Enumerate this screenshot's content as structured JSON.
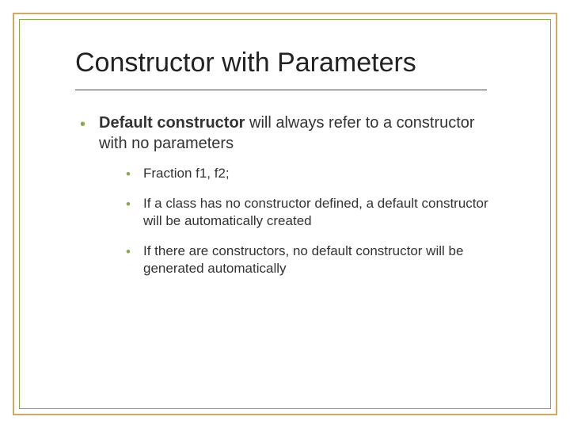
{
  "slide": {
    "title": "Constructor with Parameters",
    "bullets": [
      {
        "bold_prefix": "Default constructor",
        "rest": " will always refer to a constructor with no parameters",
        "children": [
          {
            "text": "Fraction f1, f2;"
          },
          {
            "text": "If a class has no constructor defined, a default constructor will be automatically created"
          },
          {
            "text": "If there are constructors, no default constructor will be generated automatically"
          }
        ]
      }
    ]
  },
  "colors": {
    "outer_border": "#d4a95f",
    "inner_border": "#8ca84f",
    "bullet": "#8ca84f"
  }
}
